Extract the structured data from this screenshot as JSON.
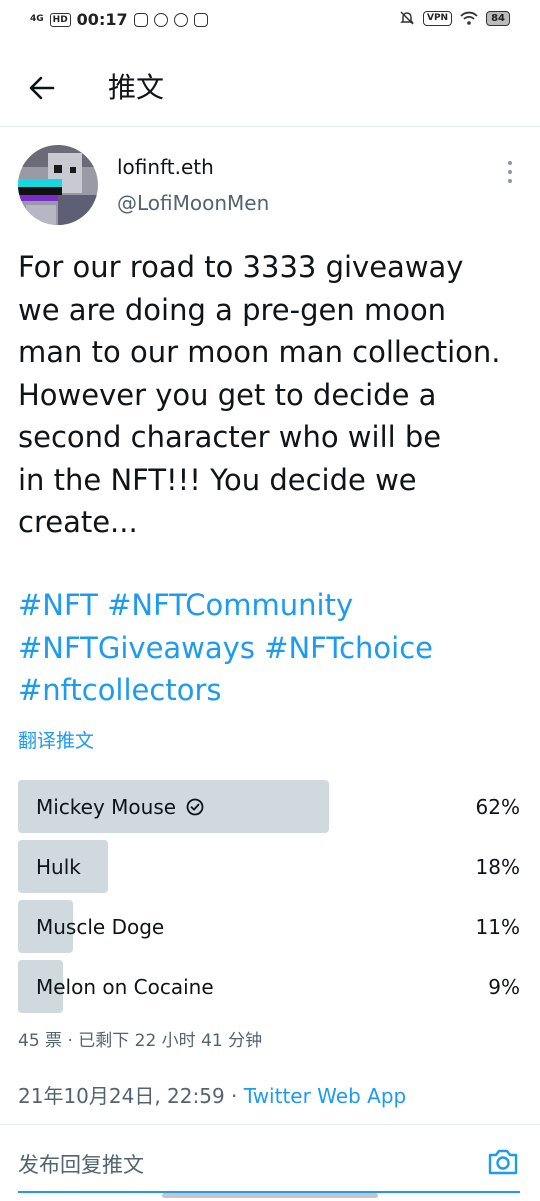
{
  "status_bar": {
    "network": "4G",
    "hd": "HD",
    "time": "00:17",
    "vpn": "VPN",
    "battery": "84"
  },
  "header": {
    "title": "推文"
  },
  "tweet": {
    "author_name": "lofinft.eth",
    "author_handle": "@LofiMoonMen",
    "text_lines": [
      "For our road to 3333 giveaway",
      "we are doing a pre-gen moon",
      "man to our moon man collection.",
      "However you get to decide a",
      "second character who will be",
      "in the NFT!!! You decide we",
      "create..."
    ],
    "hashtag_lines": [
      "#NFT #NFTCommunity",
      "#NFTGiveaways #NFTchoice",
      "#nftcollectors"
    ],
    "translate_label": "翻译推文"
  },
  "poll": {
    "options": [
      {
        "label": "Mickey Mouse",
        "percent_text": "62%",
        "fraction": 0.62,
        "winner": true
      },
      {
        "label": "Hulk",
        "percent_text": "18%",
        "fraction": 0.18,
        "winner": false
      },
      {
        "label": "Muscle Doge",
        "percent_text": "11%",
        "fraction": 0.11,
        "winner": false
      },
      {
        "label": "Melon on Cocaine",
        "percent_text": "9%",
        "fraction": 0.09,
        "winner": false
      }
    ],
    "meta": "45 票 · 已剩下 22 小时 41 分钟"
  },
  "timestamp": {
    "date_time": "21年10月24日, 22:59 · ",
    "client": "Twitter Web App"
  },
  "reply": {
    "placeholder": "发布回复推文"
  },
  "colors": {
    "link": "#1d9bf0",
    "poll_bar": "#cfd9de",
    "secondary_text": "#536471"
  },
  "icons": [
    "back-arrow-icon",
    "more-vertical-icon",
    "check-circle-icon",
    "camera-icon"
  ]
}
